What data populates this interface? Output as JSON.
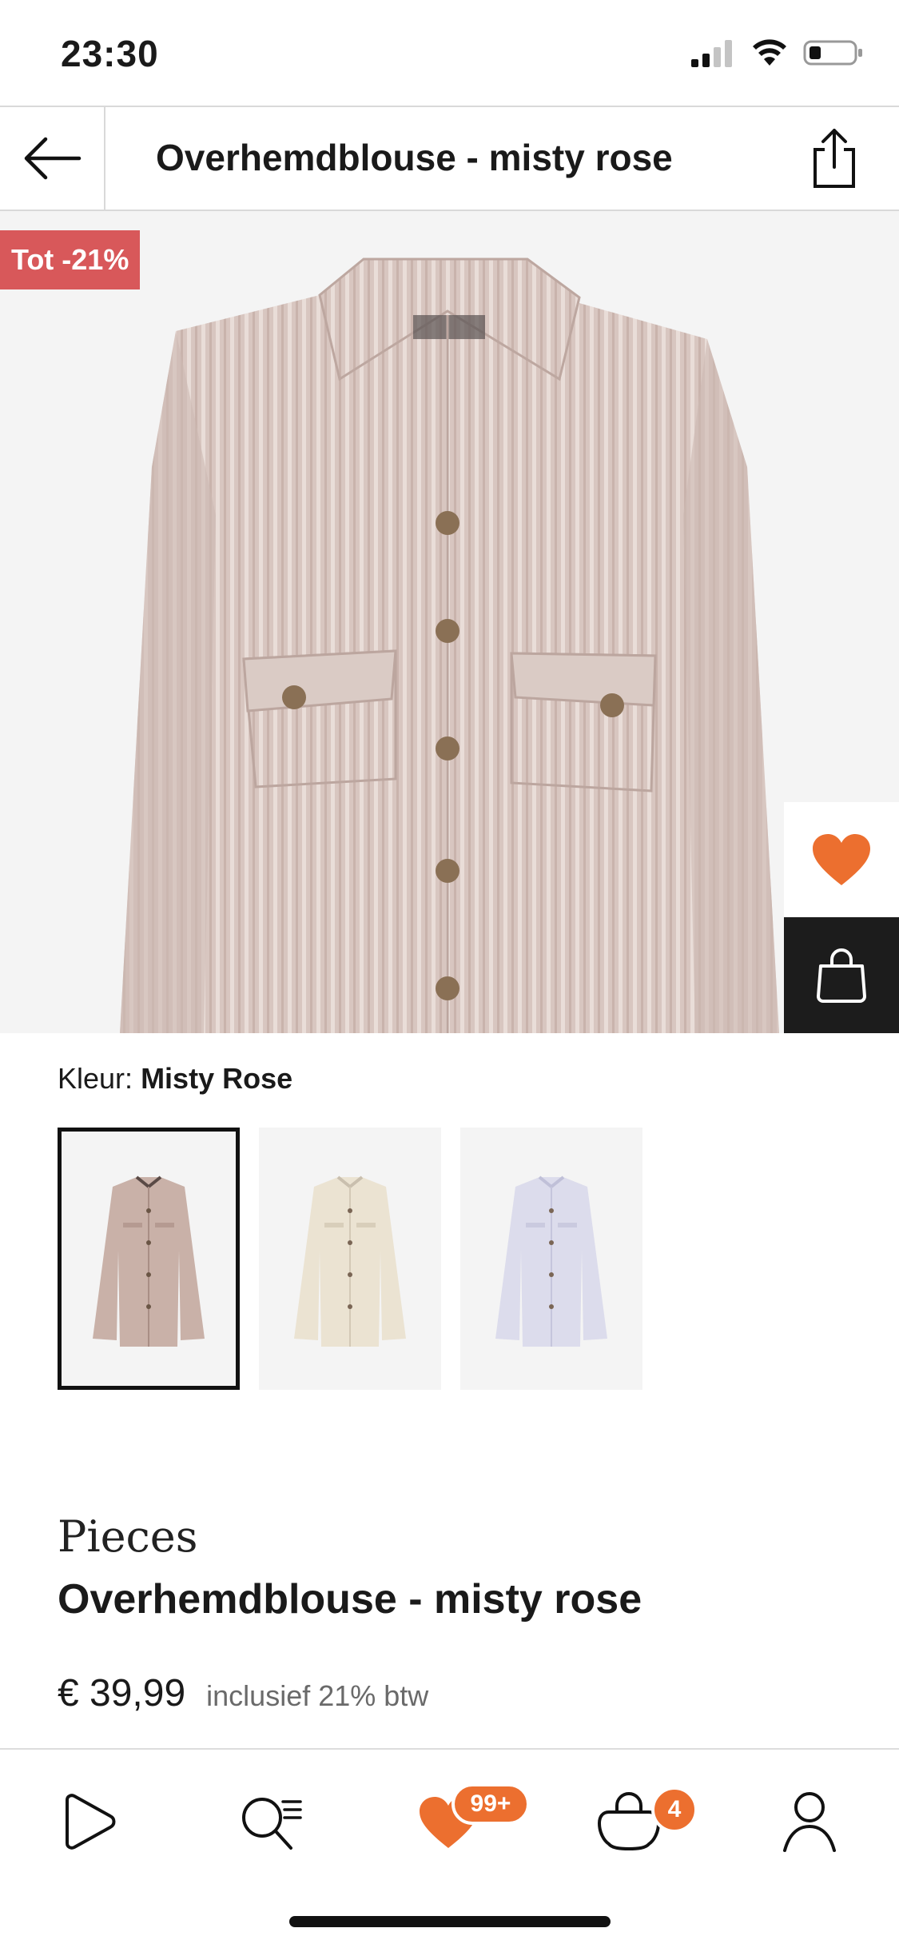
{
  "status_bar": {
    "time": "23:30",
    "icons": [
      "signal-icon",
      "wifi-icon",
      "battery-icon"
    ]
  },
  "header": {
    "title": "Overhemdblouse - misty rose",
    "back_icon": "arrow-left-icon",
    "share_icon": "share-icon"
  },
  "product_image": {
    "discount_badge": "Tot -21%",
    "wishlist_icon": "heart-icon",
    "add_to_bag_icon": "shopping-bag-icon"
  },
  "colour": {
    "label": "Kleur:",
    "selected": "Misty Rose",
    "swatches": [
      {
        "color": "#c9b1a8",
        "selected": true
      },
      {
        "color": "#ebe3d2",
        "selected": false
      },
      {
        "color": "#d9d9ea",
        "selected": false
      }
    ]
  },
  "product": {
    "brand": "Pieces",
    "name": "Overhemdblouse - misty rose",
    "price": "€ 39,99",
    "vat_note": "inclusief 21% btw"
  },
  "tab_bar": {
    "tabs": [
      {
        "icon": "home-play-icon"
      },
      {
        "icon": "search-list-icon"
      },
      {
        "icon": "heart-icon",
        "badge": "99+"
      },
      {
        "icon": "bag-icon",
        "badge": "4"
      },
      {
        "icon": "user-icon"
      }
    ]
  },
  "colors": {
    "accent": "#ec6f2f",
    "discount": "#d8585a",
    "dark": "#1c1c1c"
  }
}
